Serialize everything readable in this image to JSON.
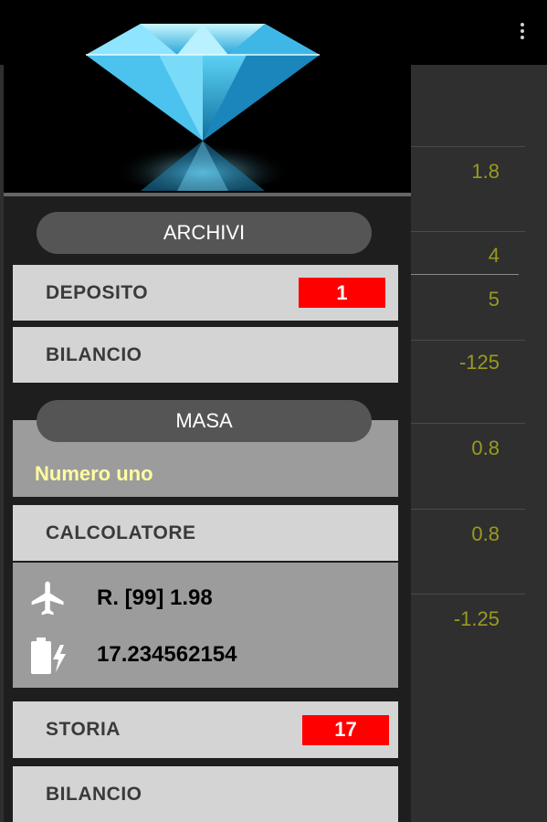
{
  "background_values": [
    "1.8",
    "4",
    "5",
    "-125",
    "0.8",
    "0.8",
    "-1.25"
  ],
  "drawer": {
    "section_archivi": "ARCHIVI",
    "deposito": {
      "label": "DEPOSITO",
      "badge": "1"
    },
    "bilancio_1": "BILANCIO",
    "section_masa": "MASA",
    "masa_subtitle": "Numero uno",
    "calcolatore": "CALCOLATORE",
    "flight_info": "R. [99] 1.98",
    "battery_info": "17.234562154",
    "storia": {
      "label": "STORIA",
      "badge": "17"
    },
    "bilancio_2": "BILANCIO"
  },
  "colors": {
    "accent_value": "#9a9a20",
    "badge": "#ff0000",
    "subtitle": "#ffffa0"
  },
  "icons": [
    "overflow-menu-icon",
    "airplane-icon",
    "battery-charging-icon",
    "diamond-image"
  ]
}
